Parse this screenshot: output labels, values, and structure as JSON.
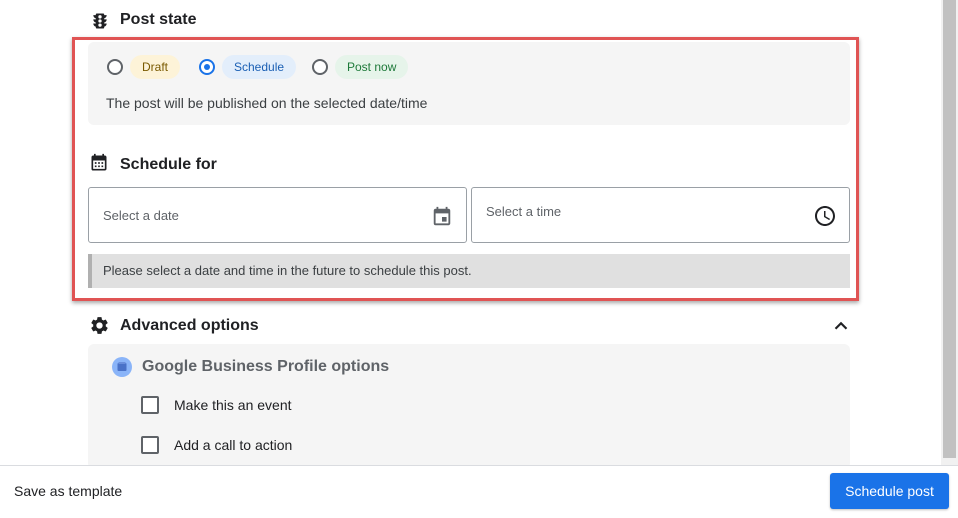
{
  "post_state": {
    "title": "Post state",
    "options": [
      {
        "label": "Draft",
        "checked": false,
        "bg": "#fdf3d8",
        "fg": "#7a5a00"
      },
      {
        "label": "Schedule",
        "checked": true,
        "bg": "#e3eefb",
        "fg": "#1a5fb4"
      },
      {
        "label": "Post now",
        "checked": false,
        "bg": "#e6f4ea",
        "fg": "#1e7a3a"
      }
    ],
    "description": "The post will be published on the selected date/time"
  },
  "schedule": {
    "title": "Schedule for",
    "date_placeholder": "Select a date",
    "time_placeholder": "Select a time",
    "notice": "Please select a date and time in the future to schedule this post."
  },
  "advanced": {
    "title": "Advanced options",
    "gbp_title": "Google Business Profile options",
    "checkboxes": [
      {
        "label": "Make this an event",
        "checked": false
      },
      {
        "label": "Add a call to action",
        "checked": false
      }
    ]
  },
  "footer": {
    "save_template_label": "Save as template",
    "schedule_button_label": "Schedule post"
  },
  "colors": {
    "highlight_border": "#e05454",
    "primary": "#1a73e8",
    "panel_bg": "#f5f5f5",
    "notice_bg": "#e0e0e0"
  }
}
